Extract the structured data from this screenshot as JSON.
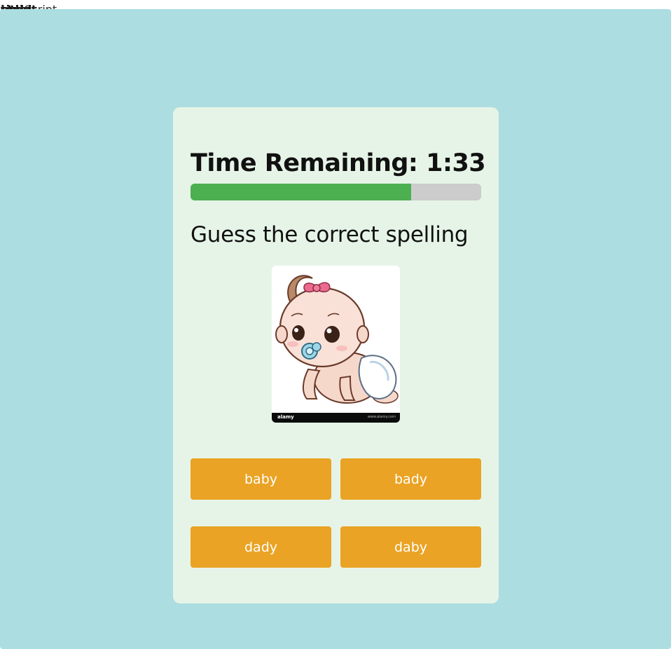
{
  "page_head": [
    "title",
    "head",
    "style",
    "script",
    "JavaScript"
  ],
  "quiz": {
    "timer_label": "Time Remaining: 1:33",
    "progress_fraction": 0.76,
    "prompt": "Guess the correct spelling",
    "picture": {
      "watermark_logo": "alamy",
      "watermark_note": "www.alamy.com"
    },
    "options": [
      "baby",
      "bady",
      "dady",
      "daby"
    ]
  },
  "colors": {
    "background": "#acdde0",
    "card": "#e6f4e7",
    "progress_fill": "#4caf50",
    "progress_track": "#cccccc",
    "option_button": "#eaa324"
  }
}
